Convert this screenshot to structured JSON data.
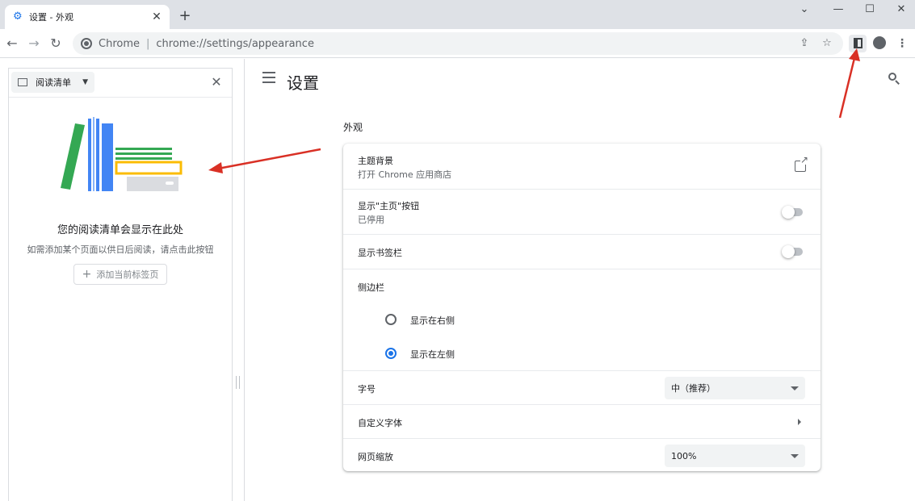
{
  "tab": {
    "title": "设置 - 外观",
    "icon": "gear-icon"
  },
  "window_controls": {
    "dropdown": "⌄",
    "minimize": "—",
    "maximize": "☐",
    "close": "✕"
  },
  "omnibox": {
    "site": "Chrome",
    "separator": "|",
    "url": "chrome://settings/appearance"
  },
  "side_panel": {
    "selector_label": "阅读清单",
    "empty_title": "您的阅读清单会显示在此处",
    "empty_desc": "如需添加某个页面以供日后阅读，请点击此按钮",
    "add_button_label": "添加当前标签页"
  },
  "settings": {
    "page_title": "设置",
    "section_title": "外观",
    "rows": {
      "theme": {
        "label": "主题背景",
        "sub": "打开 Chrome 应用商店"
      },
      "home_button": {
        "label": "显示\"主页\"按钮",
        "sub": "已停用",
        "enabled": false
      },
      "bookmarks_bar": {
        "label": "显示书签栏",
        "enabled": false
      },
      "side_panel": {
        "label": "侧边栏",
        "options": [
          "显示在右侧",
          "显示在左侧"
        ],
        "selected": "显示在左侧"
      },
      "font_size": {
        "label": "字号",
        "value": "中（推荐）"
      },
      "custom_fonts": {
        "label": "自定义字体"
      },
      "page_zoom": {
        "label": "网页缩放",
        "value": "100%"
      }
    }
  },
  "colors": {
    "accent": "#1a73e8",
    "annotation": "#d93025"
  }
}
